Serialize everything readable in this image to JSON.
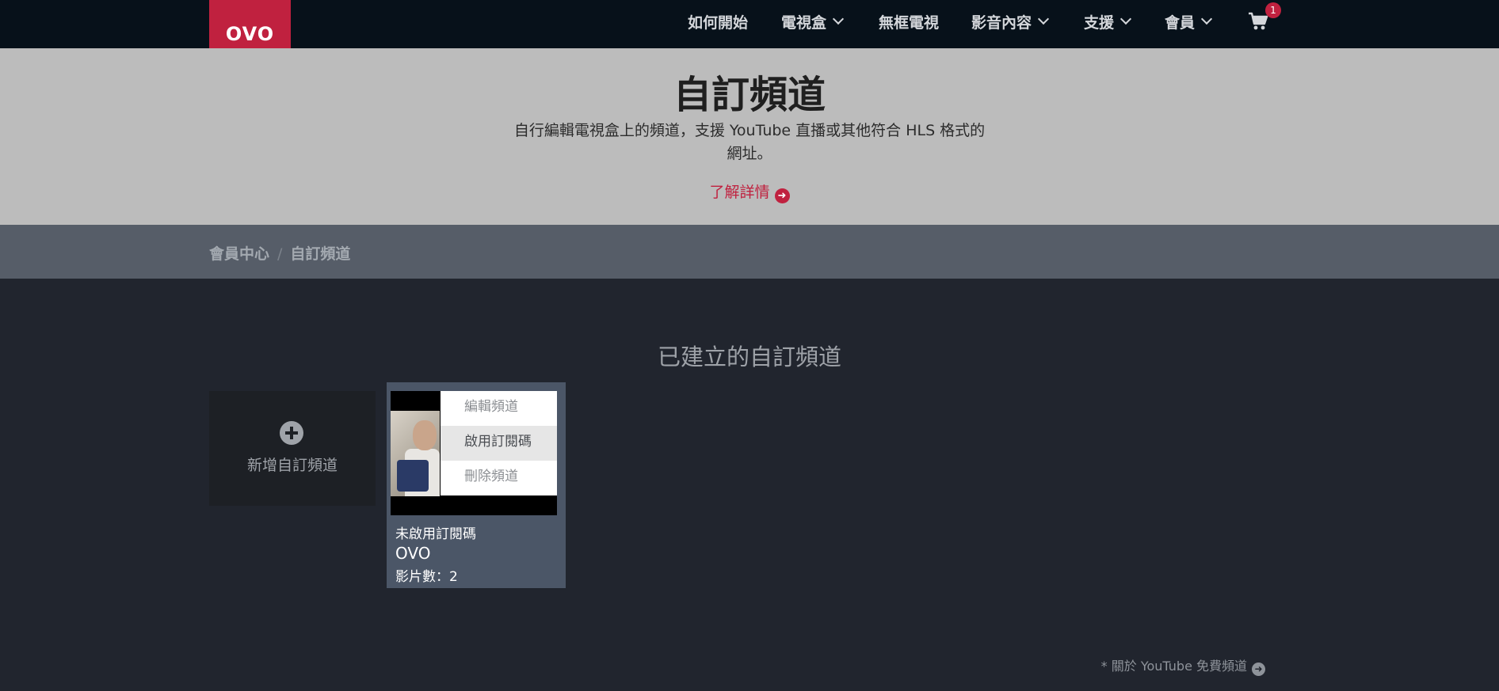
{
  "header": {
    "logo": "OVO",
    "nav": [
      {
        "label": "如何開始",
        "dropdown": false
      },
      {
        "label": "電視盒",
        "dropdown": true
      },
      {
        "label": "無框電視",
        "dropdown": false
      },
      {
        "label": "影音內容",
        "dropdown": true
      },
      {
        "label": "支援",
        "dropdown": true
      },
      {
        "label": "會員",
        "dropdown": true
      }
    ],
    "cart_icon": "cart-icon",
    "cart_count": "1"
  },
  "hero": {
    "title": "自訂頻道",
    "description": "自行編輯電視盒上的頻道，支援 YouTube 直播或其他符合 HLS 格式的網址。",
    "link": "了解詳情"
  },
  "breadcrumb": [
    "會員中心",
    "自訂頻道"
  ],
  "section": {
    "title": "已建立的自訂頻道",
    "add_label": "新增自訂頻道"
  },
  "channel": {
    "menu": [
      "編輯頻道",
      "啟用訂閱碼",
      "刪除頻道"
    ],
    "status": "未啟用訂閱碼",
    "name": "OVO",
    "count": "影片數：2"
  },
  "footer": {
    "link": "* 關於 YouTube 免費頻道"
  },
  "colors": {
    "brand": "#c0213f",
    "topbar": "#07111a",
    "page_bg": "#21252e",
    "card_bg": "#4b5667"
  }
}
